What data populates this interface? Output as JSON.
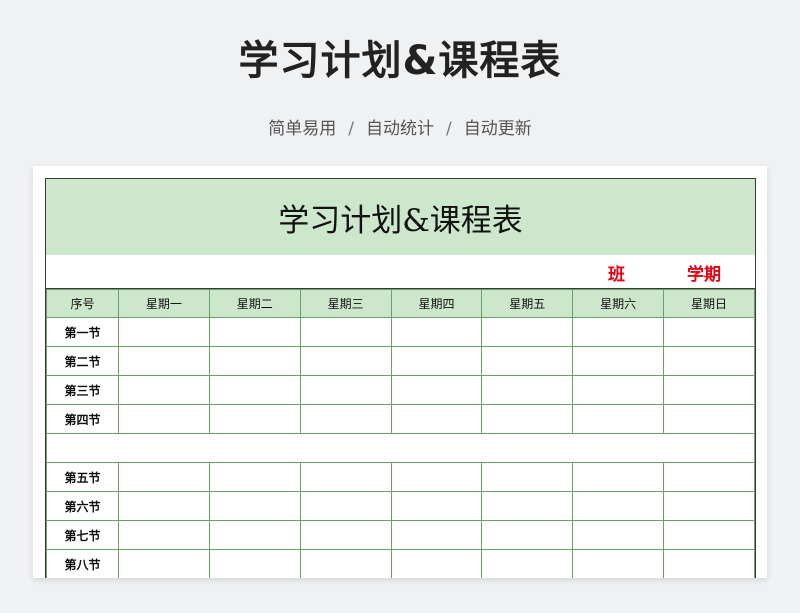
{
  "header": {
    "title": "学习计划&课程表",
    "subtitle_items": [
      "简单易用",
      "自动统计",
      "自动更新"
    ],
    "separator": "/"
  },
  "sheet": {
    "title": "学习计划&课程表",
    "class_label": "班",
    "term_label": "学期",
    "columns": [
      "序号",
      "星期一",
      "星期二",
      "星期三",
      "星期四",
      "星期五",
      "星期六",
      "星期日"
    ],
    "periods_morning": [
      "第一节",
      "第二节",
      "第三节",
      "第四节"
    ],
    "periods_afternoon": [
      "第五节",
      "第六节",
      "第七节",
      "第八节"
    ]
  },
  "colors": {
    "header_fill": "#cde7cd",
    "grid_line": "#6aa06a",
    "accent_red": "#e60012",
    "page_bg": "#f0f1f3"
  }
}
